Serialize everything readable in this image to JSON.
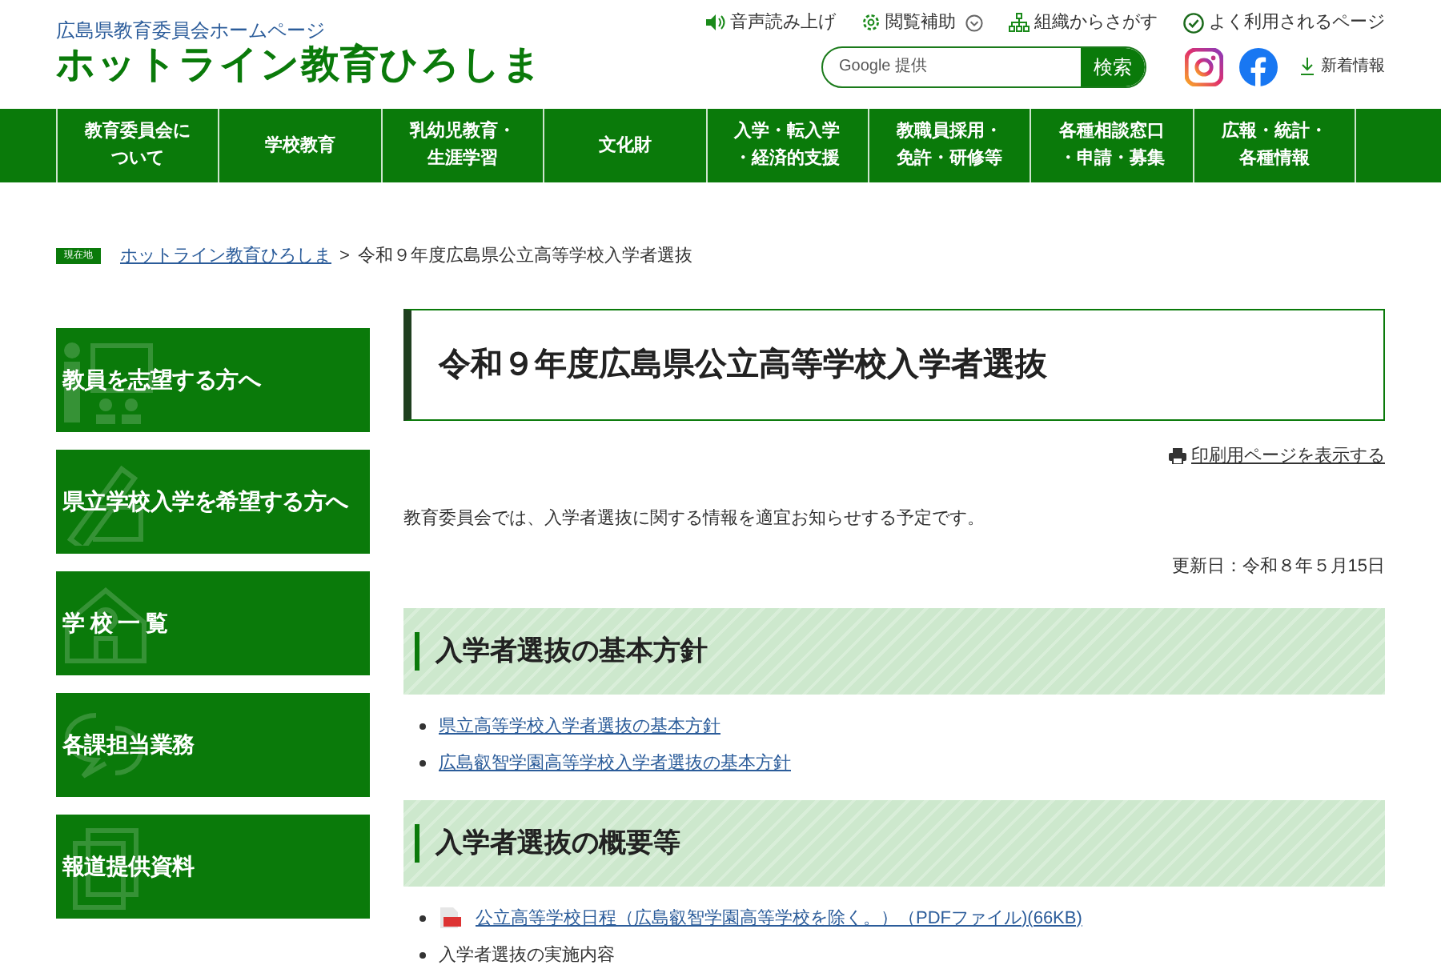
{
  "header": {
    "subtitle": "広島県教育委員会ホームページ",
    "title": "ホットライン教育ひろしま",
    "utility_links": [
      {
        "label": "音声読み上げ",
        "dropdown": false
      },
      {
        "label": "閲覧補助",
        "dropdown": true
      },
      {
        "label": "組織からさがす",
        "dropdown": false
      },
      {
        "label": "よく利用されるページ",
        "dropdown": false
      }
    ],
    "search": {
      "placeholder": "Google 提供",
      "button": "検索"
    },
    "news_link": "新着情報"
  },
  "nav": [
    [
      "教育委員会に",
      "ついて"
    ],
    [
      "学校教育"
    ],
    [
      "乳幼児教育・",
      "生涯学習"
    ],
    [
      "文化財"
    ],
    [
      "入学・転入学",
      "・経済的支援"
    ],
    [
      "教職員採用・",
      "免許・研修等"
    ],
    [
      "各種相談窓口",
      "・申請・募集"
    ],
    [
      "広報・統計・",
      "各種情報"
    ]
  ],
  "breadcrumb": {
    "badge": "現在地",
    "home": "ホットライン教育ひろしま",
    "separator": ">",
    "current": "令和９年度広島県公立高等学校入学者選抜"
  },
  "sidebar": [
    "教員を志望する方へ",
    "県立学校入学を希望する方へ",
    "学 校 一 覧",
    "各課担当業務",
    "報道提供資料"
  ],
  "main": {
    "title": "令和９年度広島県公立高等学校入学者選抜",
    "print_link": "印刷用ページを表示する",
    "intro": "教育委員会では、入学者選抜に関する情報を適宜お知らせする予定です。",
    "updated": "更新日：令和８年５月15日",
    "sections": [
      {
        "heading": "入学者選抜の基本方針",
        "items": [
          {
            "kind": "link",
            "text": "県立高等学校入学者選抜の基本方針"
          },
          {
            "kind": "link",
            "text": "広島叡智学園高等学校入学者選抜の基本方針"
          }
        ]
      },
      {
        "heading": "入学者選抜の概要等",
        "items": [
          {
            "kind": "pdf",
            "text": "公立高等学校日程（広島叡智学園高等学校を除く。）（PDFファイル)(66KB)"
          },
          {
            "kind": "text",
            "text": "入学者選抜の実施内容"
          }
        ]
      }
    ]
  }
}
